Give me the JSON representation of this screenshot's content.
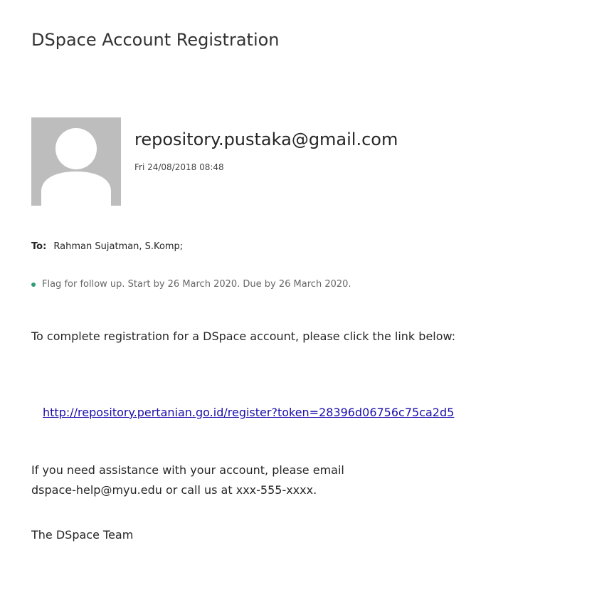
{
  "email": {
    "subject": "DSpace Account Registration",
    "sender": "repository.pustaka@gmail.com",
    "sent_time": "Fri 24/08/2018 08:48",
    "to_label": "To:",
    "to_recipient": "Rahman Sujatman, S.Komp;",
    "flag_text": "Flag for follow up. Start by 26 March 2020. Due by 26 March 2020.",
    "body": {
      "para1": "To complete registration for a DSpace account, please click the link below:",
      "link": "http://repository.pertanian.go.id/register?token=28396d06756c75ca2d5",
      "para2_line1": "If you need assistance with your account, please email",
      "para2_line2": "dspace-help@myu.edu or call us at xxx-555-xxxx.",
      "signature": "The DSpace Team"
    }
  },
  "colors": {
    "link": "#1a0dab",
    "flag_dot": "#2e9e76",
    "avatar_bg": "#bdbdbd"
  }
}
